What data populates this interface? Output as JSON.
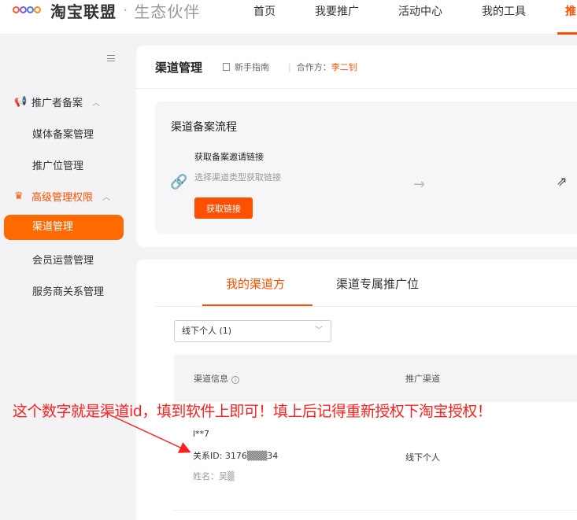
{
  "logo": {
    "brand": "淘宝联盟",
    "separator": "·",
    "subtitle": "生态伙伴"
  },
  "nav": {
    "items": [
      "首页",
      "我要推广",
      "活动中心",
      "我的工具"
    ],
    "active": "推"
  },
  "sidebar": {
    "groups": [
      {
        "label": "推广者备案",
        "icon": "megaphone-icon",
        "items": [
          "媒体备案管理",
          "推广位管理"
        ]
      },
      {
        "label": "高级管理权限",
        "icon": "crown-icon",
        "items": [
          "渠道管理",
          "会员运营管理",
          "服务商关系管理"
        ]
      }
    ],
    "active_item": "渠道管理"
  },
  "page": {
    "title": "渠道管理",
    "guide": "新手指南",
    "partner_label": "合作方：",
    "partner_name": "李二钊"
  },
  "flow": {
    "title": "渠道备案流程",
    "step_title": "获取备案邀请链接",
    "step_desc": "选择渠道类型获取链接",
    "step_button": "获取链接"
  },
  "tabs": {
    "items": [
      "我的渠道方",
      "渠道专属推广位"
    ],
    "active_index": 0
  },
  "filter": {
    "selected": "线下个人 (1)"
  },
  "table": {
    "headers": [
      "渠道信息",
      "推广渠道"
    ],
    "rows": [
      {
        "nick": "l**7",
        "relation_id": "关系ID: 3176▒▒▒34",
        "name": "姓名：吴▒",
        "channel": "线下个人"
      }
    ]
  },
  "annotation": "这个数字就是渠道id，填到软件上即可！填上后记得重新授权下淘宝授权！",
  "colors": {
    "accent": "#ff5000",
    "annotation": "#ff1f1f"
  }
}
